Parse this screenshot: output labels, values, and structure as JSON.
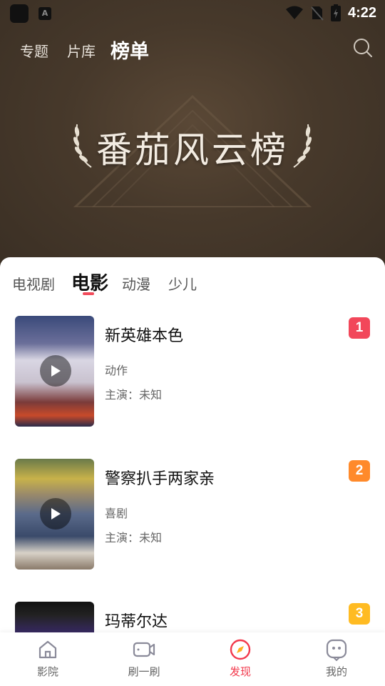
{
  "status_bar": {
    "time": "4:22",
    "app_icon_letter": "A"
  },
  "top_nav": {
    "tabs": [
      {
        "label": "专题"
      },
      {
        "label": "片库"
      },
      {
        "label": "榜单",
        "active": true
      }
    ],
    "search_icon": "search-icon"
  },
  "banner": {
    "title": "番茄风云榜"
  },
  "categories": {
    "tabs": [
      {
        "label": "电视剧"
      },
      {
        "label": "电影",
        "active": true
      },
      {
        "label": "动漫"
      },
      {
        "label": "少儿"
      }
    ]
  },
  "list": {
    "items": [
      {
        "title": "新英雄本色",
        "genre": "动作",
        "cast": "主演：未知",
        "rank": "1",
        "rank_color": "#f2475a"
      },
      {
        "title": "警察扒手两家亲",
        "genre": "喜剧",
        "cast": "主演：未知",
        "rank": "2",
        "rank_color": "#ff8a2b"
      },
      {
        "title": "玛蒂尔达",
        "genre": "",
        "cast": "",
        "rank": "3",
        "rank_color": "#ffbb22"
      }
    ]
  },
  "bottom_nav": {
    "items": [
      {
        "label": "影院",
        "icon": "home-icon"
      },
      {
        "label": "刷一刷",
        "icon": "video-icon"
      },
      {
        "label": "发现",
        "icon": "compass-icon",
        "active": true
      },
      {
        "label": "我的",
        "icon": "profile-icon"
      }
    ]
  },
  "colors": {
    "accent": "#f2394c",
    "hero_bg": "#47392b"
  }
}
